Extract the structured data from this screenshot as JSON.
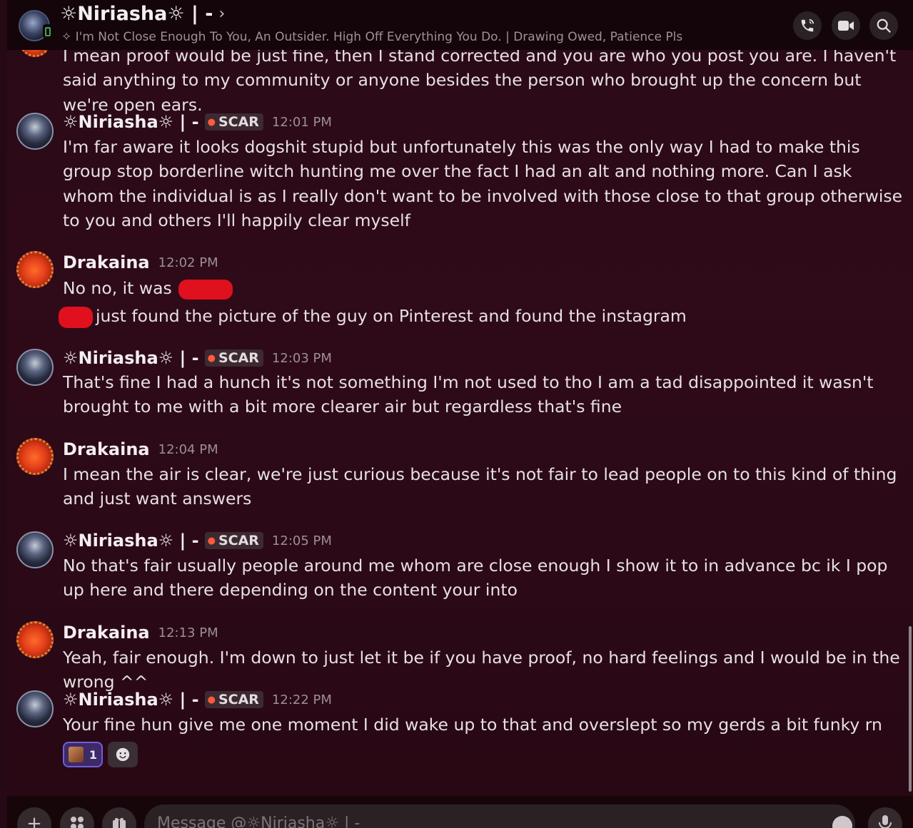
{
  "header": {
    "title": "☼Niriasha☼ | -",
    "status": "✧ I'm Not Close Enough To You, An Outsider. High Off Everything You Do. | Drawing Owed, Patience Pls",
    "chevron": "›"
  },
  "messages": [
    {
      "type": "continuation",
      "text": "I mean proof would be just fine, then I stand corrected and you are who you post you are. I haven't said anything to my community or anyone besides the person who brought up the concern but we're open ears."
    },
    {
      "author": "☼Niriasha☼ | -",
      "tag": "SCAR",
      "time": "12:01 PM",
      "text": "I'm far aware it looks dogshit stupid but unfortunately this was the only way I had to make this group stop borderline witch hunting me over the fact I had an alt and nothing more. Can I ask whom the individual is as I really don't want to be involved with those close to that group otherwise to you and others I'll happily clear myself"
    },
    {
      "author": "Drakaina",
      "time": "12:02 PM",
      "text": "No no, it was",
      "text2": "just found the picture of the guy on Pinterest and found the instagram"
    },
    {
      "author": "☼Niriasha☼ | -",
      "tag": "SCAR",
      "time": "12:03 PM",
      "text": "That's fine I had a hunch it's not something I'm not used to tho I am a tad disappointed it wasn't brought to me with a bit more clearer air but regardless that's fine"
    },
    {
      "author": "Drakaina",
      "time": "12:04 PM",
      "text": "I mean the air is clear, we're just curious because it's not fair to lead people on to this kind of thing and just want answers"
    },
    {
      "author": "☼Niriasha☼ | -",
      "tag": "SCAR",
      "time": "12:05 PM",
      "text": "No that's fair usually people around me whom are close enough I show it to in advance bc ik I pop up here and there depending on the content your into"
    },
    {
      "author": "Drakaina",
      "time": "12:13 PM",
      "text": "Yeah, fair enough. I'm down to just let it be if you have proof, no hard feelings and I would be in the wrong ^^"
    },
    {
      "author": "☼Niriasha☼ | -",
      "tag": "SCAR",
      "time": "12:22 PM",
      "text": "Your fine hun give me one moment I did wake up to that and overslept so my gerds a bit funky rn",
      "reaction_count": "1"
    }
  ],
  "composer": {
    "placeholder": "Message @☼Niriasha☼ | -"
  },
  "icons": {
    "call": "phone-icon",
    "video": "video-icon",
    "search": "search-icon",
    "plus": "plus-icon",
    "apps": "apps-icon",
    "gift": "gift-icon",
    "emoji": "emoji-icon",
    "mic": "mic-icon"
  },
  "colors": {
    "background": "#2b0916",
    "header": "#130509",
    "redaction": "#e0101e",
    "reaction_active": "#3d2a66"
  }
}
